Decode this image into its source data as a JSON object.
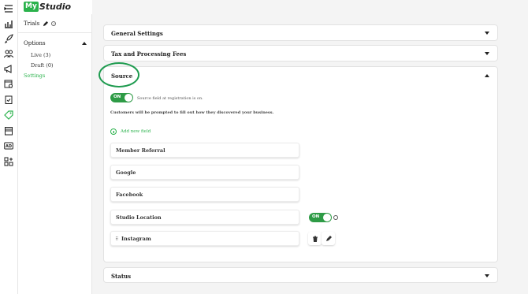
{
  "app": {
    "logo_box": "My",
    "logo_text": "Studio"
  },
  "rail_icons": [
    "menu-icon",
    "chart-icon",
    "rocket-icon",
    "users-icon",
    "megaphone-icon",
    "calendar-gear-icon",
    "clipboard-check-icon",
    "tag-icon",
    "store-icon",
    "ad-icon",
    "apps-add-icon"
  ],
  "sidebar": {
    "trials_label": "Trials",
    "options_label": "Options",
    "live_label": "Live (3)",
    "draft_label": "Draft (0)",
    "settings_label": "Settings"
  },
  "accordions": {
    "general": "General Settings",
    "tax": "Tax and Processing Fees",
    "source": "Source",
    "status": "Status"
  },
  "source": {
    "toggle_label": "ON",
    "toggle_note": "Source field at registration is on.",
    "description": "Customers will be prompted to fill out how they discovered your business.",
    "add_field_label": "Add new field",
    "fields": [
      {
        "label": "Member Referral"
      },
      {
        "label": "Google"
      },
      {
        "label": "Facebook"
      },
      {
        "label": "Studio Location",
        "toggle": "ON"
      },
      {
        "label": "Instagram"
      }
    ]
  },
  "colors": {
    "accent": "#2bb24c",
    "toggle": "#2e9b46",
    "highlight_ring": "#1e9b4f"
  }
}
